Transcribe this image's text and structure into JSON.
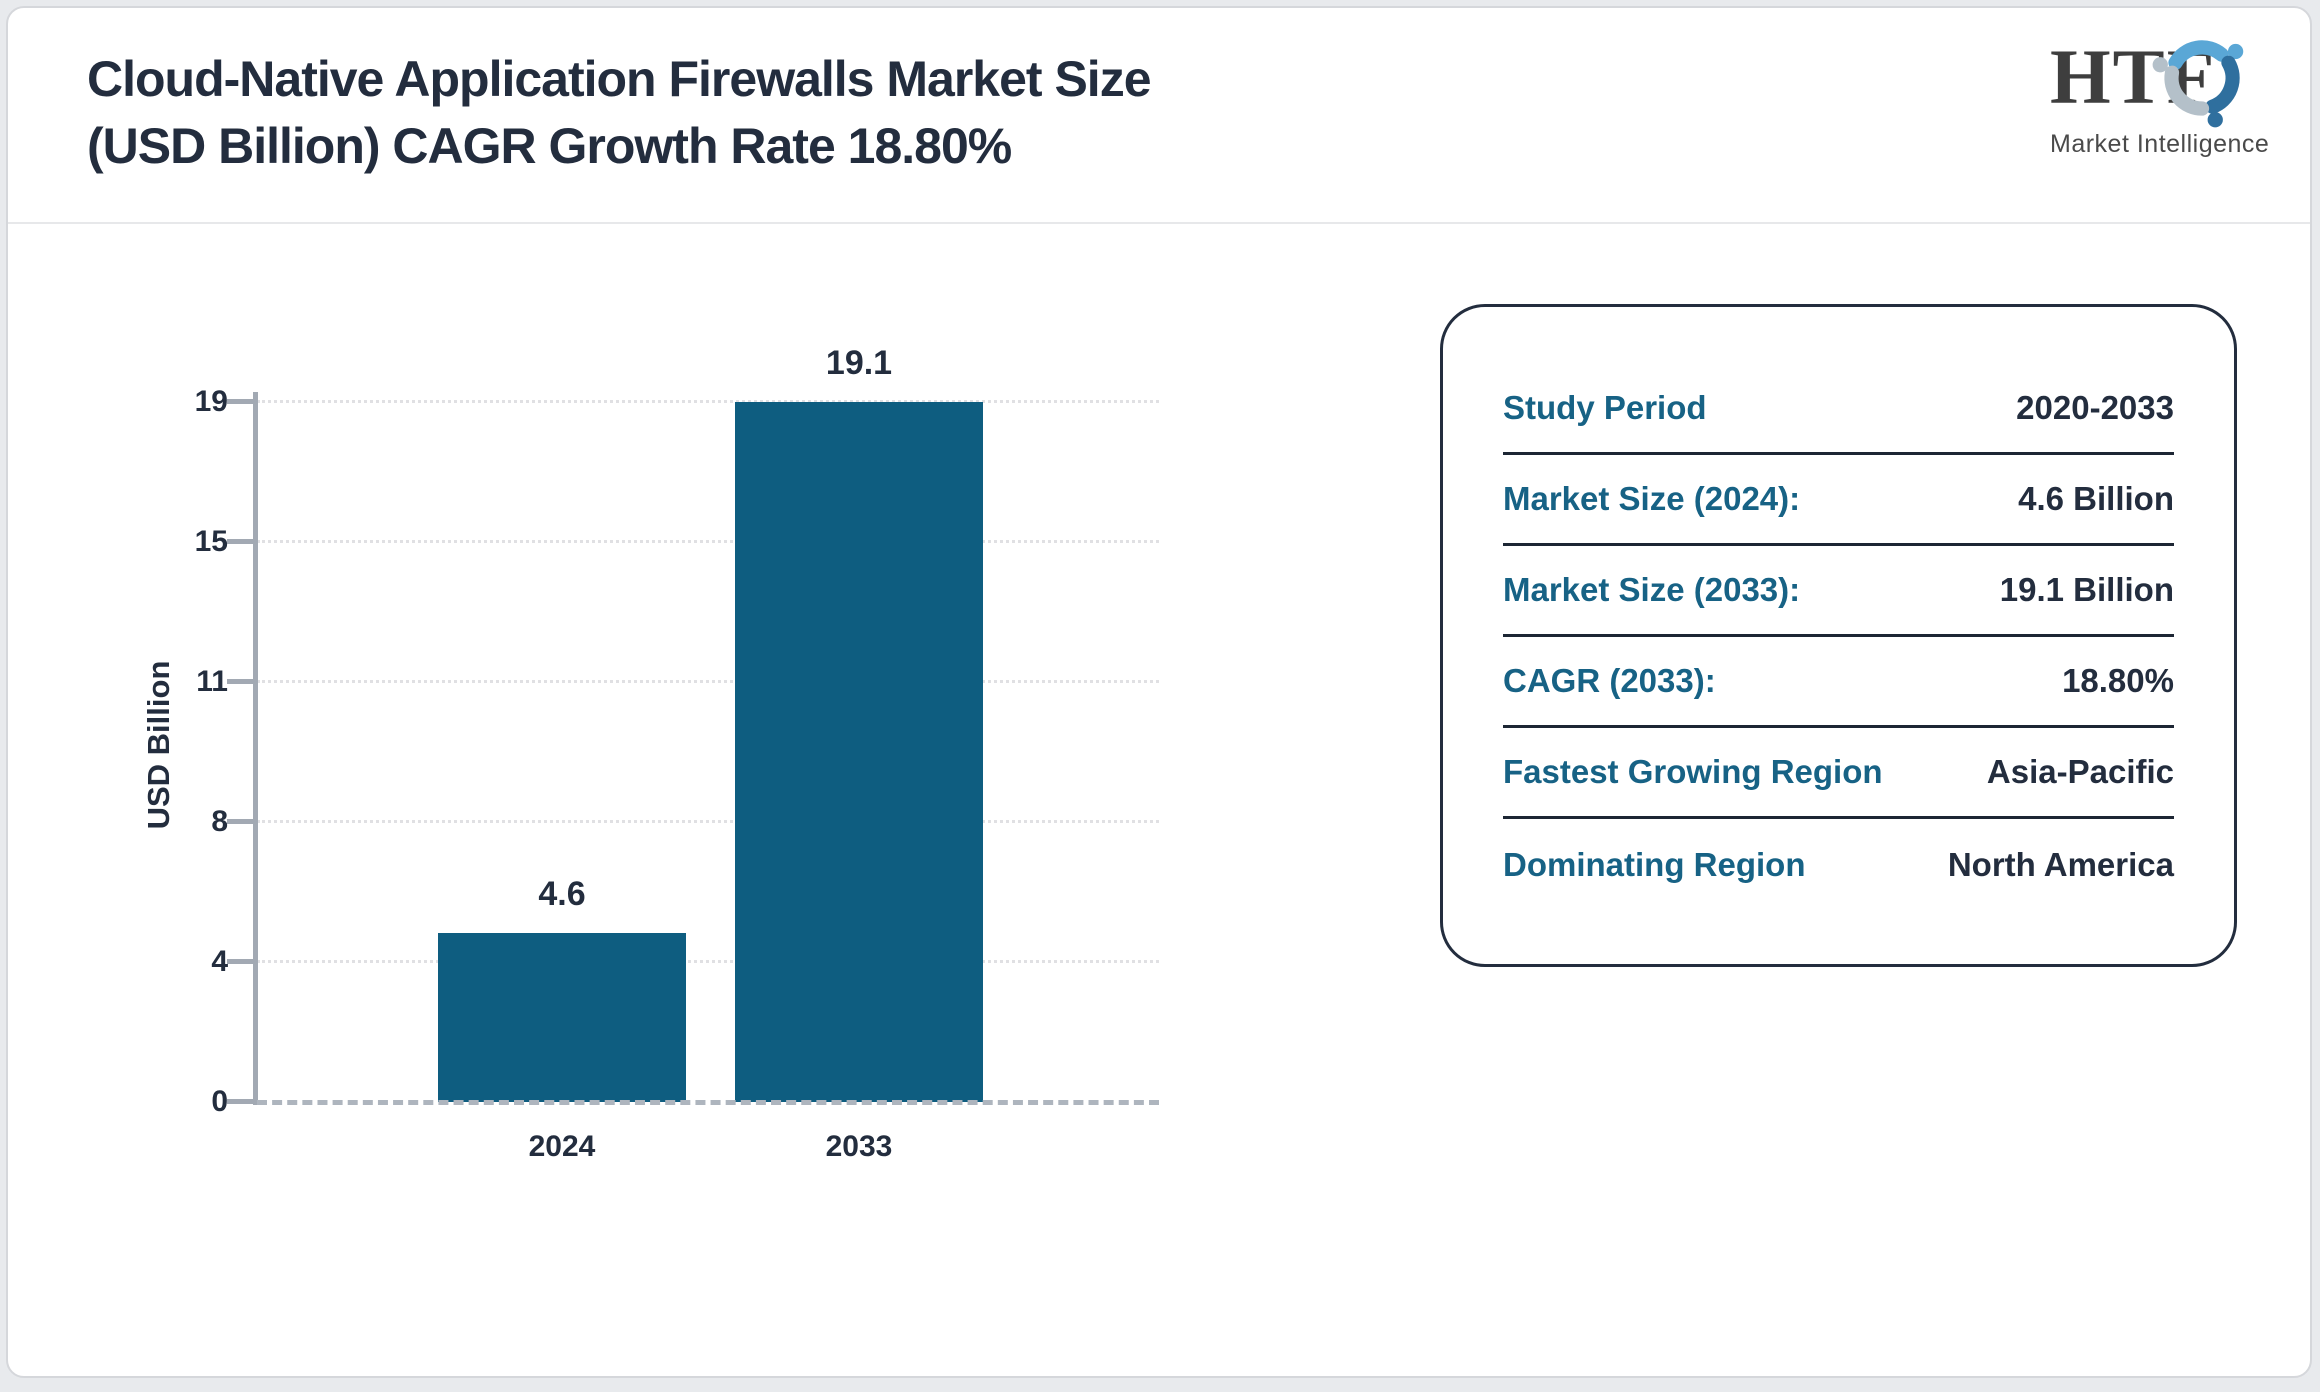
{
  "header": {
    "title_line1": "Cloud-Native Application Firewalls Market Size",
    "title_line2": "(USD Billion) CAGR Growth Rate 18.80%",
    "logo": {
      "text": "HTF",
      "subtitle": "Market Intelligence"
    }
  },
  "chart_data": {
    "type": "bar",
    "title": "Cloud-Native Application Firewalls Market Size (USD Billion) CAGR Growth Rate 18.80%",
    "categories": [
      "2024",
      "2033"
    ],
    "values": [
      4.6,
      19.1
    ],
    "bar_labels": [
      "4.6",
      "19.1"
    ],
    "xlabel": "",
    "ylabel": "USD Billion",
    "ylim": [
      0,
      19.1
    ],
    "ytick_labels": [
      "0",
      "4",
      "8",
      "11",
      "15",
      "19"
    ],
    "grid": "horizontal-dotted",
    "legend": "none"
  },
  "info_panel": {
    "rows": [
      {
        "label": "Study Period",
        "value": "2020-2033"
      },
      {
        "label": "Market Size (2024):",
        "value": "4.6 Billion"
      },
      {
        "label": "Market Size (2033):",
        "value": "19.1 Billion"
      },
      {
        "label": "CAGR (2033):",
        "value": "18.80%"
      },
      {
        "label": "Fastest Growing Region",
        "value": "Asia-Pacific"
      },
      {
        "label": "Dominating Region",
        "value": "North America"
      }
    ]
  },
  "colors": {
    "bar": "#0e5d80",
    "title_text": "#232d3e",
    "panel_label": "#176285",
    "panel_value": "#232d3e",
    "panel_border": "#232d3e",
    "axis": "#a2a9b3",
    "gridline": "#e0e0e3",
    "zero_line": "#aeb5be",
    "logo_light_blue": "#5aa7d6",
    "logo_gray_blue": "#b4c0c9",
    "logo_dark_blue": "#2f6f9e"
  }
}
